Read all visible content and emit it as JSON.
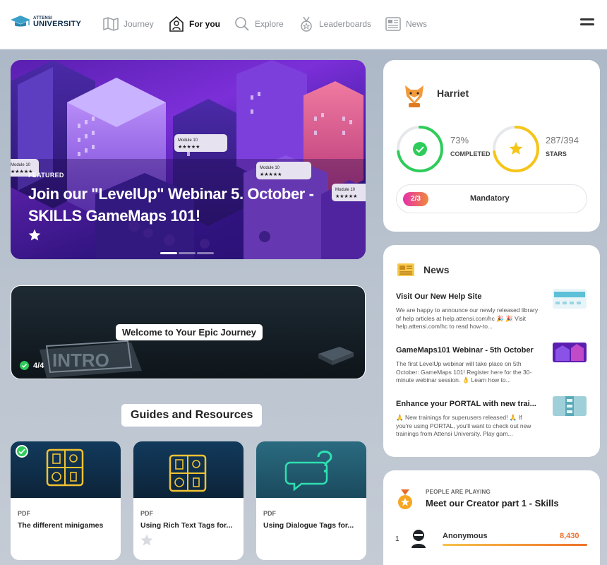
{
  "brand": {
    "small": "ATTENSI",
    "big": "UNIVERSITY"
  },
  "nav": [
    {
      "label": "Journey",
      "icon": "map-icon"
    },
    {
      "label": "For you",
      "icon": "house-person-icon",
      "active": true
    },
    {
      "label": "Explore",
      "icon": "search-icon"
    },
    {
      "label": "Leaderboards",
      "icon": "medal-icon"
    },
    {
      "label": "News",
      "icon": "newspaper-icon"
    }
  ],
  "hero": {
    "tag": "FEATURED",
    "title": "Join our \"LevelUp\" Webinar 5. October - SKILLS GameMaps 101!",
    "module_label": "Module 10",
    "module_stars": "★★★★★",
    "carousel_pages": 3,
    "carousel_active": 1
  },
  "intro": {
    "title": "Welcome to Your Epic Journey",
    "art_text": "INTRO",
    "progress": "4/4"
  },
  "guides": {
    "title": "Guides and Resources",
    "items": [
      {
        "type": "PDF",
        "name": "The different minigames",
        "completed": true
      },
      {
        "type": "PDF",
        "name": "Using Rich Text Tags for...",
        "completed": false
      },
      {
        "type": "PDF",
        "name": "Using Dialogue Tags for...",
        "completed": false
      }
    ]
  },
  "profile": {
    "name": "Harriet",
    "completed_value": "73%",
    "completed_label": "COMPLETED",
    "completed_fraction": 0.73,
    "stars_value": "287/394",
    "stars_label": "STARS",
    "stars_fraction": 0.728,
    "mandatory_badge": "2/3",
    "mandatory_label": "Mandatory"
  },
  "news": {
    "title": "News",
    "items": [
      {
        "title": "Visit Our New Help Site",
        "body": "We are happy to announce our newly released library of help articles at help.attensi.com/hc 🎉 🎉 Visit help.attensi.com/hc to read how-to..."
      },
      {
        "title": "GameMaps101 Webinar - 5th October",
        "body": "The first LevelUp webinar will take place on 5th October: GameMaps 101! Register here for the 30-minute webinar session. 👌 Learn how to..."
      },
      {
        "title": "Enhance your PORTAL with new trai...",
        "body": "🙏 New trainings for superusers released! 🙏 If you're using PORTAL, you'll want to check out new trainings from Attensi University. Play gam..."
      }
    ]
  },
  "leaderboard": {
    "subtitle": "PEOPLE ARE PLAYING",
    "title": "Meet our Creator part 1 - Skills",
    "rows": [
      {
        "rank": "1",
        "name": "Anonymous",
        "score": "8,430"
      }
    ]
  },
  "colors": {
    "accent_green": "#2ecc5a",
    "accent_yellow": "#f5c518",
    "accent_orange": "#f0702a",
    "accent_pink": "#e62faa"
  }
}
